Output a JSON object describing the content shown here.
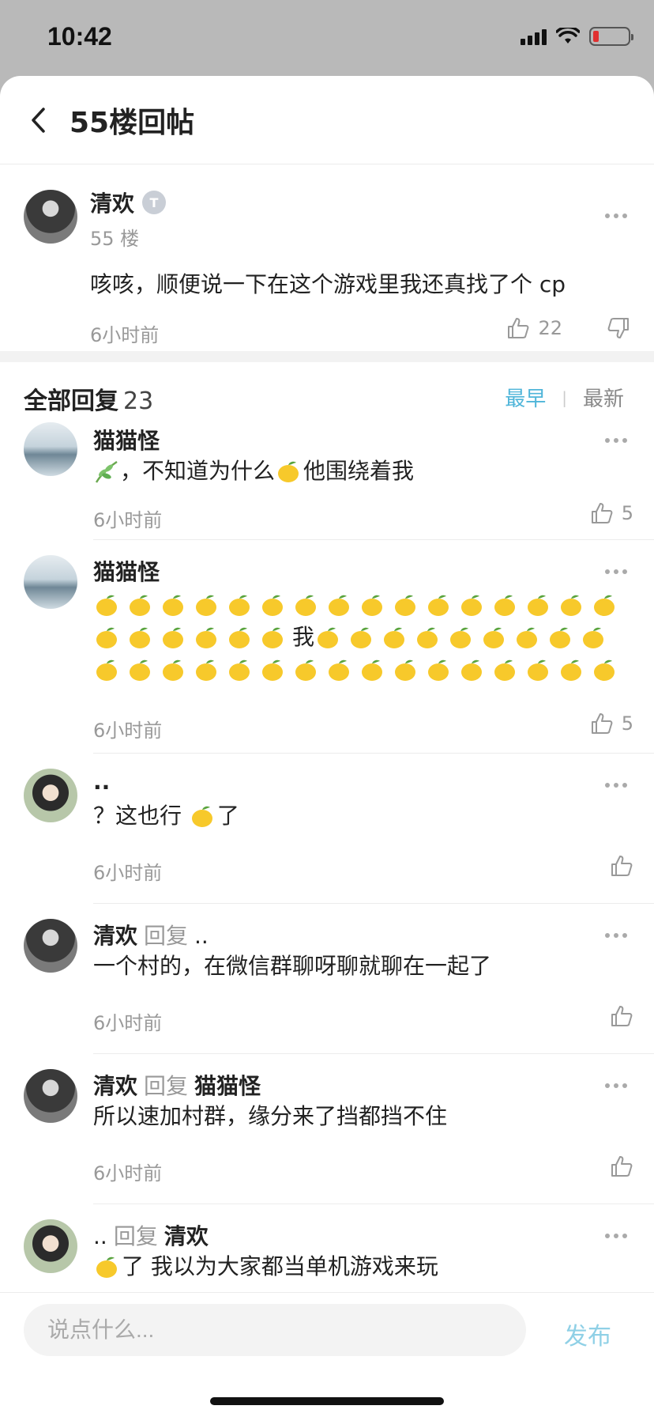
{
  "status": {
    "time": "10:42"
  },
  "nav": {
    "title": "55楼回帖"
  },
  "post": {
    "author": "清欢",
    "badge": "T",
    "floor": "55 楼",
    "content": "咳咳，顺便说一下在这个游戏里我还真找了个 cp",
    "time": "6小时前",
    "likes": "22"
  },
  "replies_header": {
    "title": "全部回复",
    "count": "23",
    "sort_earliest": "最早",
    "sort_latest": "最新",
    "sort_separator": "|"
  },
  "replies": [
    {
      "name": "猫猫怪",
      "reply_to": "",
      "target": "",
      "text_a": "，不知道为什么",
      "text_b": "他围绕着我",
      "time": "6小时前",
      "likes": "5"
    },
    {
      "name": "猫猫怪",
      "reply_to": "",
      "target": "",
      "text_mid": "我",
      "time": "6小时前",
      "likes": "5"
    },
    {
      "name": "..",
      "reply_to": "",
      "target": "",
      "text_a": "？这也行 ",
      "text_b": "了",
      "time": "6小时前",
      "likes": ""
    },
    {
      "name": "清欢",
      "reply_to": "回复",
      "target": "..",
      "text": "一个村的，在微信群聊呀聊就聊在一起了",
      "time": "6小时前",
      "likes": ""
    },
    {
      "name": "清欢",
      "reply_to": "回复",
      "target": "猫猫怪",
      "text": "所以速加村群，缘分来了挡都挡不住",
      "time": "6小时前",
      "likes": ""
    },
    {
      "name": "..",
      "reply_to": "回复",
      "target": "清欢",
      "text": "了 我以为大家都当单机游戏来玩",
      "time": "",
      "likes": ""
    }
  ],
  "composer": {
    "placeholder": "说点什么...",
    "publish": "发布"
  },
  "colors": {
    "accent": "#4fb5d9",
    "publish_disabled": "#8fd0e6"
  }
}
